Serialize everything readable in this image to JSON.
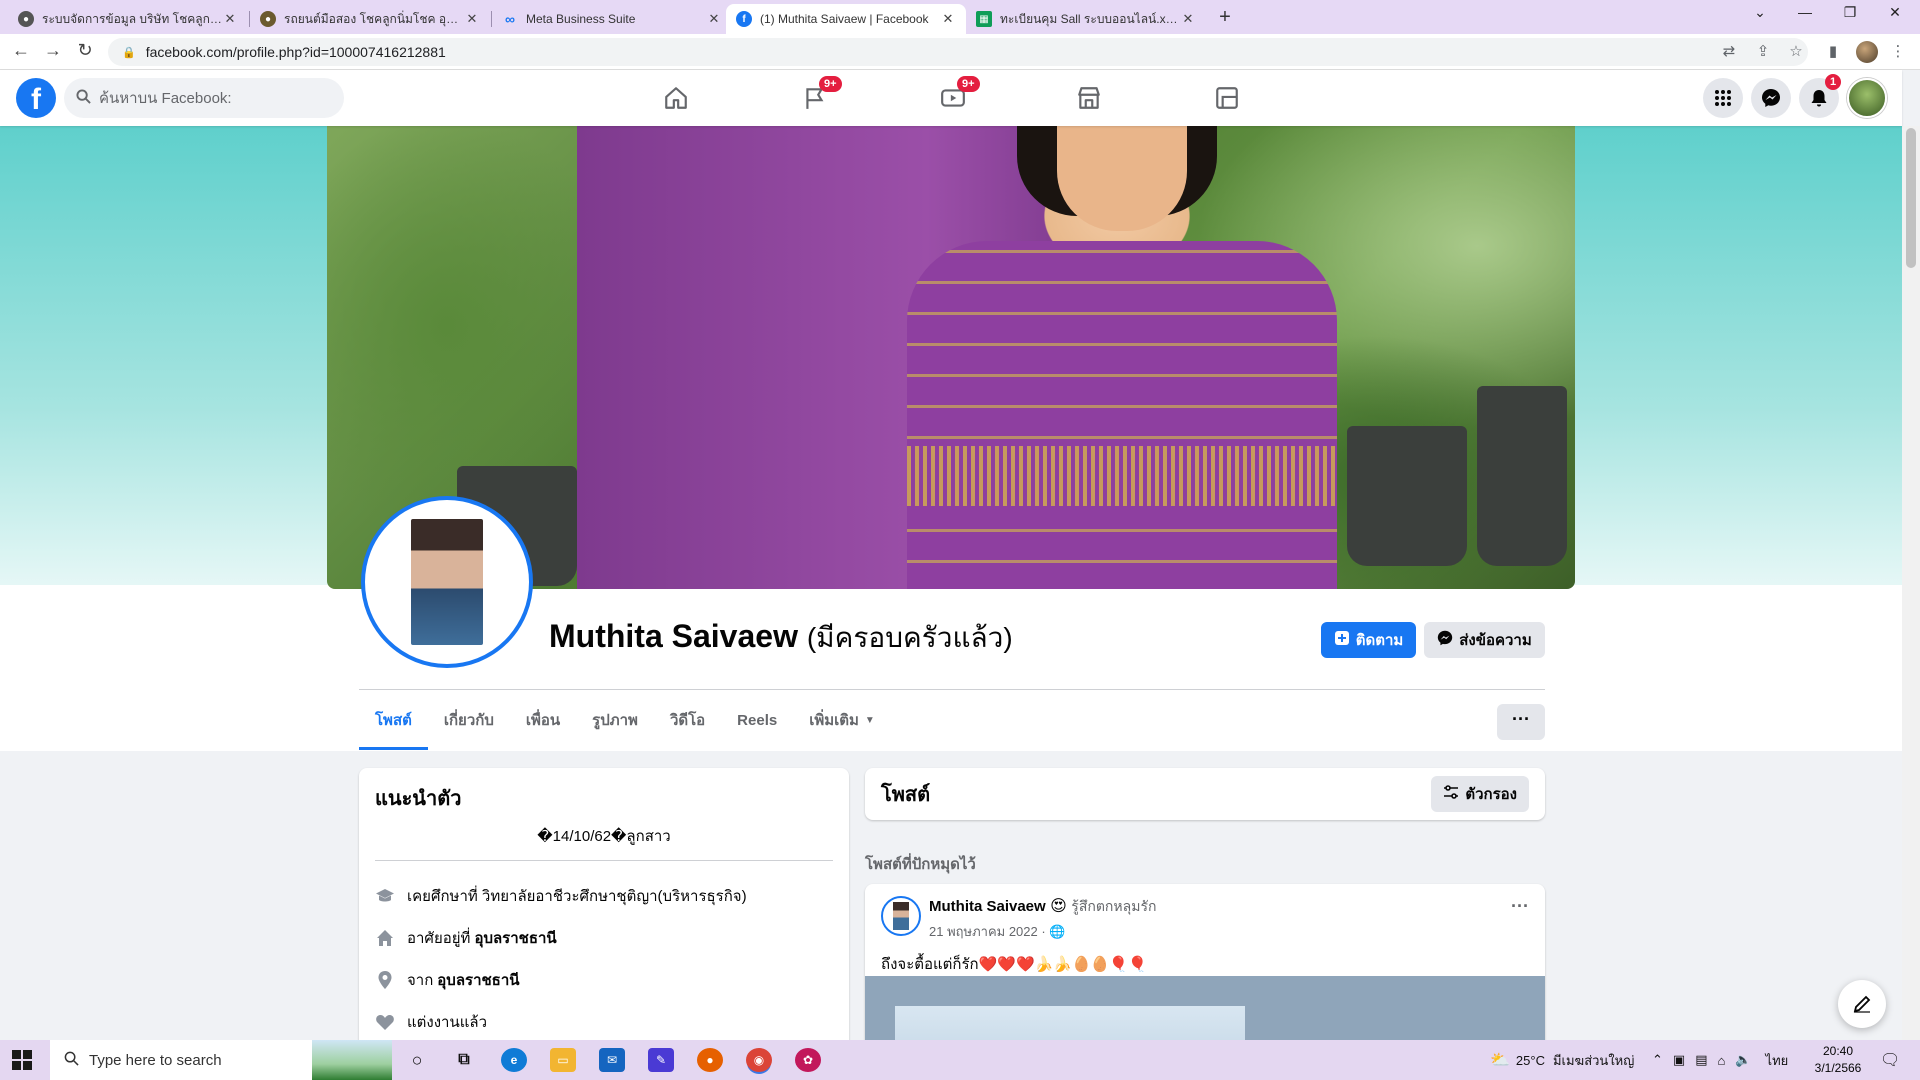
{
  "browser": {
    "tabs": [
      {
        "title": "ระบบจัดการข้อมูล บริษัท โชคลูกนิ่มโชค อุดรธานี",
        "icon": "globe-icon",
        "active": false
      },
      {
        "title": "รถยนต์มือสอง โชคลูกนิ่มโชค อุดรธานี",
        "icon": "site-icon",
        "active": false
      },
      {
        "title": "Meta Business Suite",
        "icon": "meta-icon",
        "active": false
      },
      {
        "title": "(1) Muthita Saivaew | Facebook",
        "icon": "facebook-icon",
        "active": true
      },
      {
        "title": "ทะเบียนคุม Sall ระบบออนไลน์.xlsx - Google Sheets",
        "icon": "sheets-icon",
        "active": false
      }
    ],
    "url": "facebook.com/profile.php?id=100007416212881"
  },
  "fb": {
    "logo": "f",
    "search_placeholder": "ค้นหาบน Facebook:",
    "badges": {
      "pages": "9+",
      "watch": "9+",
      "notifications": "1"
    },
    "accent": "#1877f2"
  },
  "profile": {
    "name": "Muthita Saivaew",
    "alt_name": "(มีครอบครัวแล้ว)",
    "follow_label": "ติดตาม",
    "message_label": "ส่งข้อความ",
    "tabs": [
      "โพสต์",
      "เกี่ยวกับ",
      "เพื่อน",
      "รูปภาพ",
      "วิดีโอ",
      "Reels",
      "เพิ่มเติม"
    ],
    "more_dots": "···"
  },
  "intro": {
    "title": "แนะนำตัว",
    "bio": "�14/10/62�ลูกสาว",
    "study_prefix": "เคยศึกษาที่ วิทยาลัยอาชีวะศึกษาชุติญา(บริหารธุรกิจ)",
    "lives_prefix": "อาศัยอยู่ที่",
    "lives_value": "อุบลราชธานี",
    "from_prefix": "จาก",
    "from_value": "อุบลราชธานี",
    "relationship": "แต่งงานแล้ว"
  },
  "posts": {
    "title": "โพสต์",
    "filter_label": "ตัวกรอง",
    "pinned_label": "โพสต์ที่ปักหมุดไว้",
    "post": {
      "author": "Muthita Saivaew",
      "feeling": "รู้สึกตกหลุมรัก",
      "date": "21 พฤษภาคม 2022 ·",
      "text": "ถึงจะตื้อแต่ก็รัก❤️❤️❤️🍌🍌🥚🥚🎈🎈"
    }
  },
  "taskbar": {
    "search_placeholder": "Type here to search",
    "weather": "25°C",
    "weather_text": "มีเมฆส่วนใหญ่",
    "lang": "ไทย",
    "time": "20:40",
    "date": "3/1/2566"
  }
}
